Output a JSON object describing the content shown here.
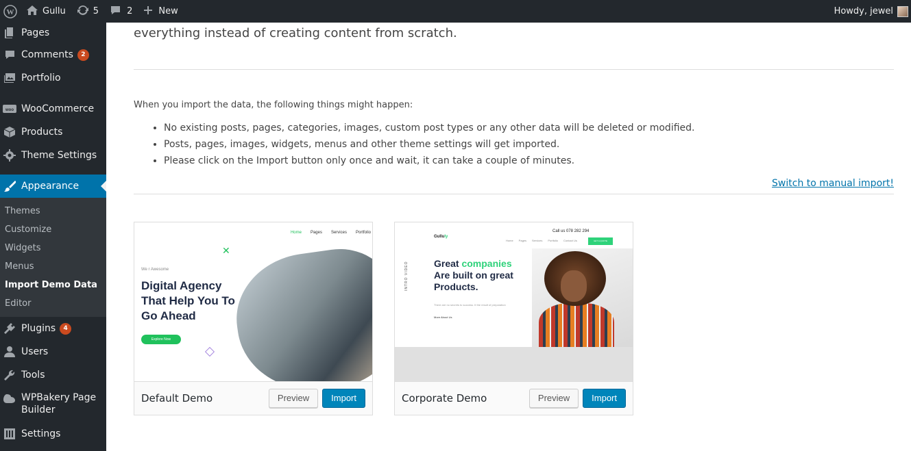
{
  "adminbar": {
    "site_name": "Gullu",
    "updates_count": "5",
    "comments_count": "2",
    "new_label": "New",
    "greeting": "Howdy, jewel"
  },
  "sidebar": {
    "items": [
      {
        "label": "Pages"
      },
      {
        "label": "Comments",
        "badge": "2"
      },
      {
        "label": "Portfolio"
      },
      {
        "label": "WooCommerce"
      },
      {
        "label": "Products"
      },
      {
        "label": "Theme Settings"
      },
      {
        "label": "Appearance"
      },
      {
        "label": "Plugins",
        "badge": "4"
      },
      {
        "label": "Users"
      },
      {
        "label": "Tools"
      },
      {
        "label": "WPBakery Page Builder"
      },
      {
        "label": "Settings"
      }
    ],
    "submenu": [
      "Themes",
      "Customize",
      "Widgets",
      "Menus",
      "Import Demo Data",
      "Editor"
    ],
    "active_submenu": "Import Demo Data"
  },
  "main": {
    "intro_text": "everything instead of creating content from scratch.",
    "info_label": "When you import the data, the following things might happen:",
    "bullets": [
      "No existing posts, pages, categories, images, custom post types or any other data will be deleted or modified.",
      "Posts, pages, images, widgets, menus and other theme settings will get imported.",
      "Please click on the Import button only once and wait, it can take a couple of minutes."
    ],
    "manual_link": "Switch to manual import!"
  },
  "demos": [
    {
      "title": "Default Demo",
      "preview_label": "Preview",
      "import_label": "Import",
      "shot": {
        "nav": [
          "Home",
          "Pages",
          "Services",
          "Portfolio"
        ],
        "small": "We r Awesome",
        "heading": "Digital Agency That Help You To Go Ahead",
        "button": "Explore Now"
      }
    },
    {
      "title": "Corporate Demo",
      "preview_label": "Preview",
      "import_label": "Import",
      "shot": {
        "logo_a": "Gullu",
        "logo_b": "ly",
        "phone": "Call us  078 282 294",
        "nav": [
          "Home",
          "Pages",
          "Services",
          "Portfolio",
          "Contact Us"
        ],
        "cta": "GET A QUOTE",
        "heading_a": "Great ",
        "heading_b": "companies",
        "heading_c": " Are built on great Products.",
        "sub": "There are no secrets to success. It the result of preparation",
        "more": "More About Us",
        "video": "INTRO VIDEO"
      }
    }
  ],
  "colors": {
    "accent": "#0073aa",
    "badge": "#ca4a1f",
    "adminbar": "#23282d"
  }
}
